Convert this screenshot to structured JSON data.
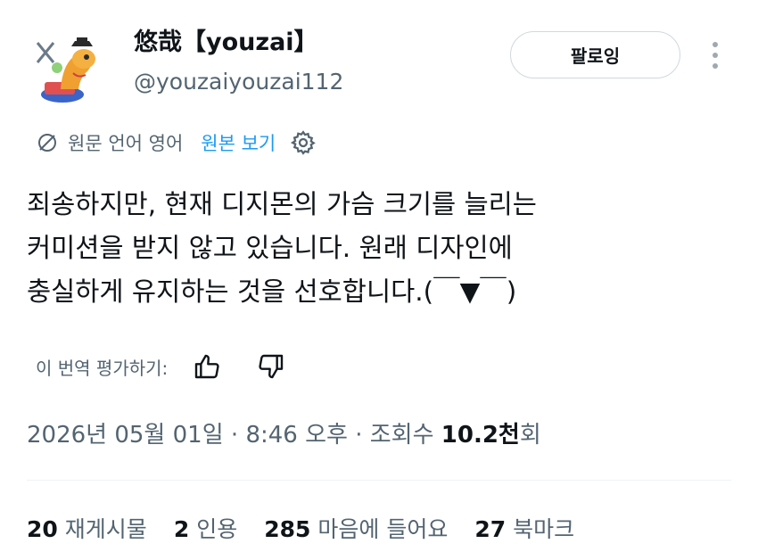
{
  "author": {
    "display_name": "悠哉【youzai】",
    "handle": "@youzaiyouzai112",
    "avatar_icon": "cartoon-dinosaur-avatar"
  },
  "follow_button_label": "팔로잉",
  "more_icon": "more-vertical-icon",
  "translation": {
    "icon": "translate-icon",
    "language_note": "원문 언어 영어",
    "show_original_label": "원본 보기",
    "settings_icon": "gear-icon"
  },
  "tweet": {
    "text": "죄송하지만, 현재 디지몬의 가슴 크기를 늘리는\n커미션을 받지 않고 있습니다. 원래 디자인에\n충실하게 유지하는 것을 선호합니다.(￣▼￣)"
  },
  "rating": {
    "label": "이 번역 평가하기:",
    "up_icon": "thumbs-up-icon",
    "down_icon": "thumbs-down-icon"
  },
  "meta": {
    "date": "2026년 05월 01일",
    "separator": " · ",
    "time": "8:46 오후",
    "views_label": "조회수 ",
    "views_count": "10.2천",
    "views_suffix": "회"
  },
  "stats": [
    {
      "count": "20",
      "label": "재게시물"
    },
    {
      "count": "2",
      "label": "인용"
    },
    {
      "count": "285",
      "label": "마음에 들어요"
    },
    {
      "count": "27",
      "label": "북마크"
    }
  ],
  "colors": {
    "accent": "#1d9bf0",
    "text_primary": "#0f1419",
    "text_secondary": "#536471",
    "border": "#cfd9de"
  }
}
